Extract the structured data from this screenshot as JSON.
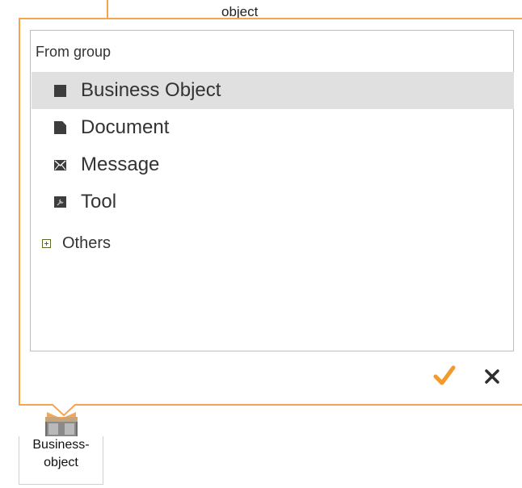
{
  "canvas": {
    "top_label": "object",
    "node_label_line1": "Business-",
    "node_label_line2": "object"
  },
  "popup": {
    "group_header": "From group",
    "items": [
      {
        "label": "Business Object",
        "icon": "business-object-icon",
        "selected": true
      },
      {
        "label": "Document",
        "icon": "document-icon",
        "selected": false
      },
      {
        "label": "Message",
        "icon": "message-icon",
        "selected": false
      },
      {
        "label": "Tool",
        "icon": "tool-icon",
        "selected": false
      }
    ],
    "others_label": "Others",
    "confirm_icon": "checkmark-icon",
    "cancel_icon": "close-icon"
  },
  "colors": {
    "accent": "#f5a552",
    "confirm": "#f39a2e",
    "selection": "#e0e0e0",
    "expander": "#5a6b2a"
  }
}
